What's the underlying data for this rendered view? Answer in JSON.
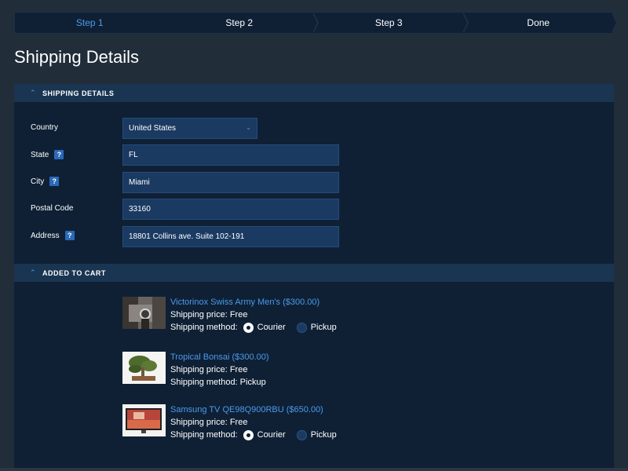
{
  "wizard": {
    "steps": [
      "Step 1",
      "Step 2",
      "Step 3",
      "Done"
    ]
  },
  "page_title": "Shipping Details",
  "shipping_section": {
    "header": "SHIPPING DETAILS",
    "fields": {
      "country": {
        "label": "Country",
        "value": "United States"
      },
      "state": {
        "label": "State",
        "value": "FL"
      },
      "city": {
        "label": "City",
        "value": "Miami"
      },
      "postal": {
        "label": "Postal Code",
        "value": "33160"
      },
      "address": {
        "label": "Address",
        "value": "18801 Collins ave. Suite 102-191"
      }
    },
    "help_glyph": "?"
  },
  "cart_section": {
    "header": "ADDED TO CART",
    "items": [
      {
        "name": "Victorinox Swiss Army Men's ($300.00)",
        "price_line": "Shipping price: Free",
        "method_label": "Shipping method:",
        "option_a": "Courier",
        "option_b": "Pickup",
        "selected": "Courier"
      },
      {
        "name": "Tropical Bonsai ($300.00)",
        "price_line": "Shipping price: Free",
        "method_line": "Shipping method: Pickup"
      },
      {
        "name": "Samsung TV QE98Q900RBU ($650.00)",
        "price_line": "Shipping price: Free",
        "method_label": "Shipping method:",
        "option_a": "Courier",
        "option_b": "Pickup",
        "selected": "Courier"
      }
    ]
  },
  "colors": {
    "accent": "#4a9be8",
    "background": "#212d39",
    "panel": "#0f2035",
    "section_header": "#1a3552",
    "field": "#1a3a62"
  },
  "icons": {
    "section_toggle": "chevron-up-icon",
    "select_caret": "chevron-down-icon"
  }
}
